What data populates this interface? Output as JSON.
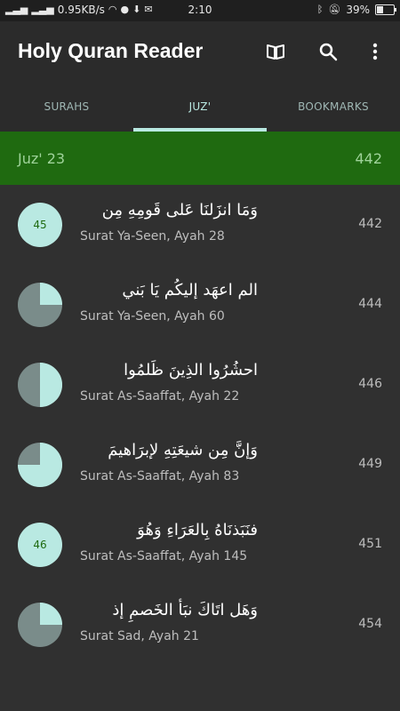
{
  "status_bar": {
    "speed": "0.95KB/s",
    "time": "2:10",
    "battery": "39%",
    "battery_level": 0.39
  },
  "app_bar": {
    "title": "Holy Quran Reader",
    "icons": [
      "book-icon",
      "search-icon",
      "more-vert-icon"
    ]
  },
  "tabs": [
    {
      "label": "SURAHS",
      "active": false
    },
    {
      "label": "JUZ'",
      "active": true
    },
    {
      "label": "BOOKMARKS",
      "active": false
    }
  ],
  "juz_header": {
    "name": "Juz' 23",
    "page": "442"
  },
  "items": [
    {
      "arabic": "وَمَا انزَلنَا عَلى قَومِهِ مِن",
      "ref": "Surat Ya-Seen, Ayah 28",
      "page": "442",
      "indicator_type": "number",
      "number": "45"
    },
    {
      "arabic": "الم اعهَد إليكُم يَا بَني",
      "ref": "Surat Ya-Seen, Ayah 60",
      "page": "444",
      "indicator_type": "pie",
      "fraction": 0.25
    },
    {
      "arabic": "احشُرُوا الذِينَ ظَلمُوا",
      "ref": "Surat As-Saaffat, Ayah 22",
      "page": "446",
      "indicator_type": "pie",
      "fraction": 0.5
    },
    {
      "arabic": "وَإنَّ مِن شيعَتِهِ لإبرَاهيمَ",
      "ref": "Surat As-Saaffat, Ayah 83",
      "page": "449",
      "indicator_type": "pie",
      "fraction": 0.75
    },
    {
      "arabic": "فنَبَذنَاهُ بِالعَرَاءِ وَهُوَ",
      "ref": "Surat As-Saaffat, Ayah 145",
      "page": "451",
      "indicator_type": "number",
      "number": "46"
    },
    {
      "arabic": "وَهَل اتَاكَ نبَأ الخَصمِ إذ",
      "ref": "Surat Sad, Ayah 21",
      "page": "454",
      "indicator_type": "pie",
      "fraction": 0.25
    }
  ],
  "colors": {
    "accent": "#b9e9e2",
    "header_green": "#1f6a10",
    "pie_dark": "#7a8c8a"
  }
}
